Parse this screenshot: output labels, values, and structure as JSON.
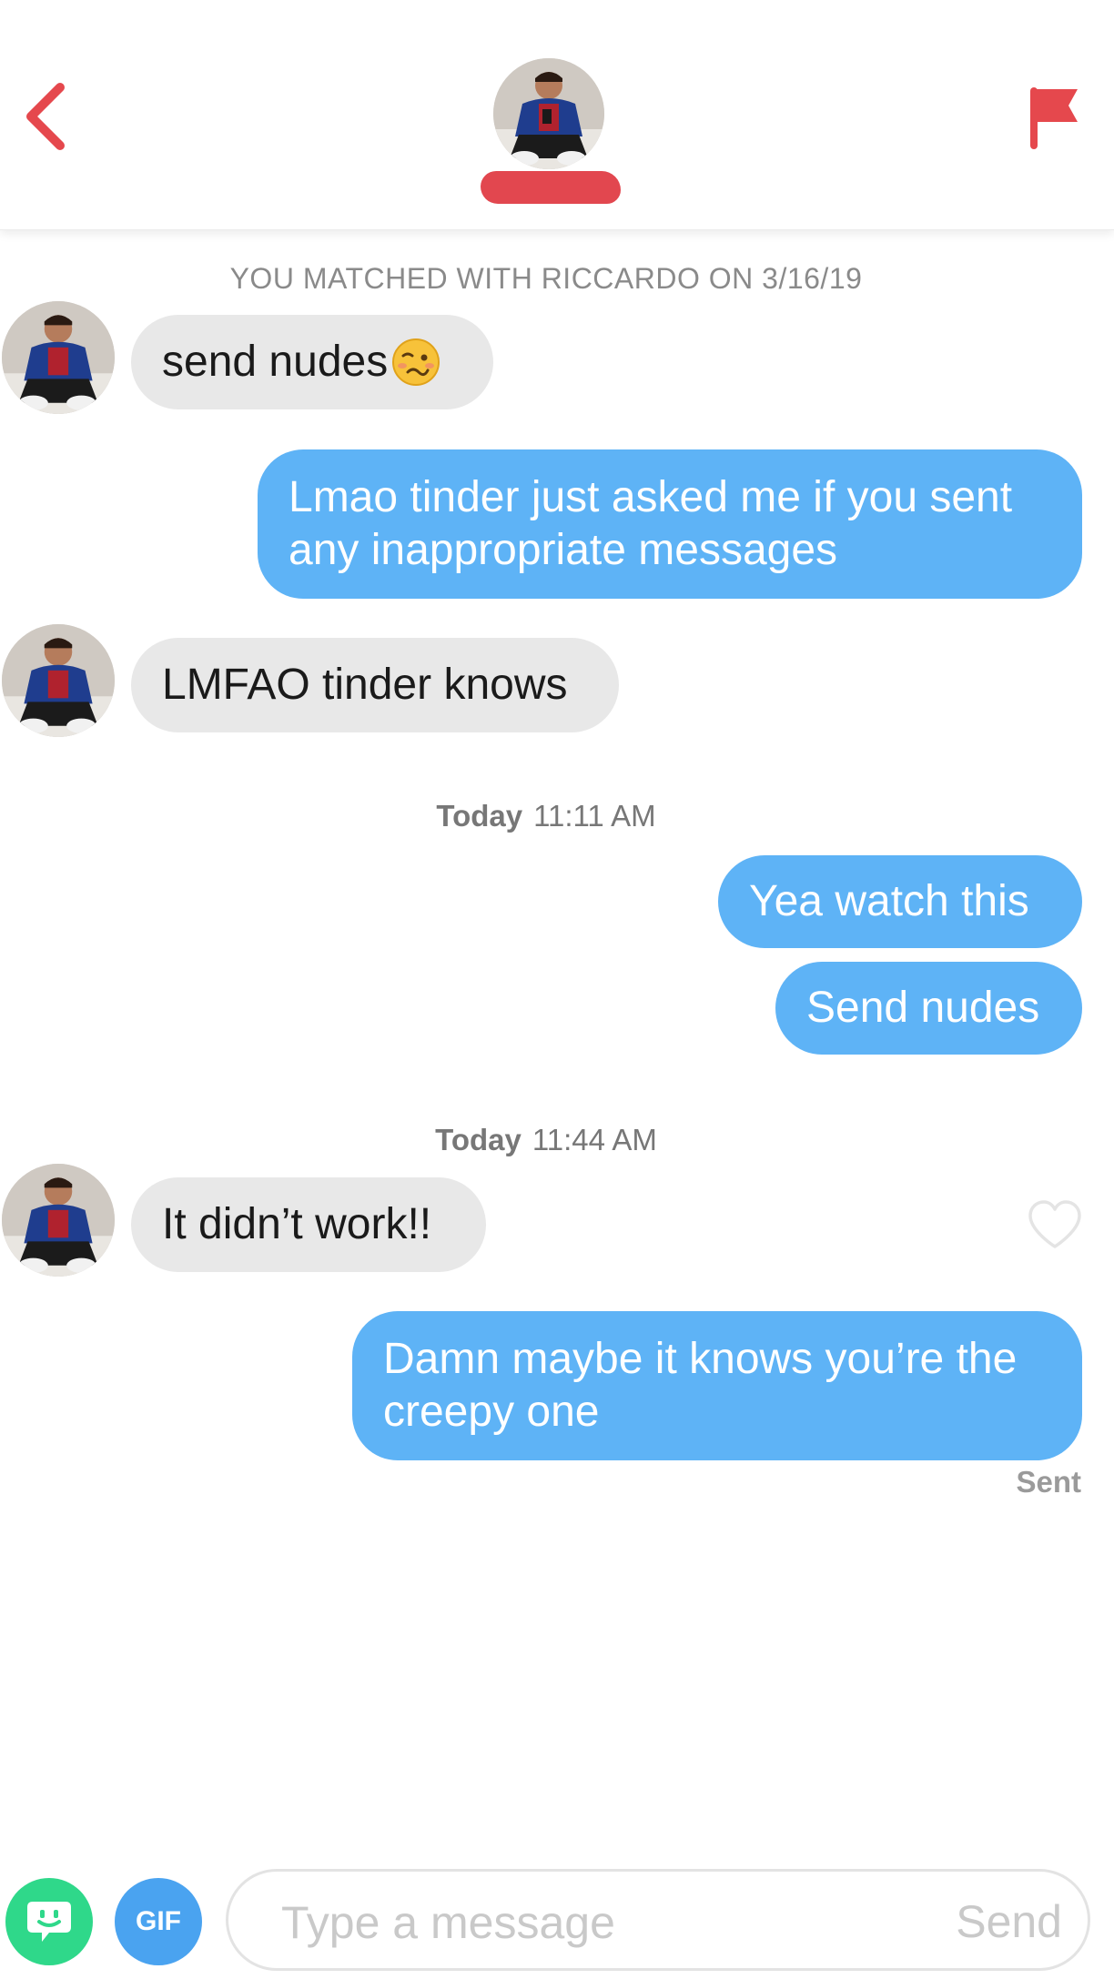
{
  "header": {
    "back_icon": "chevron-left-icon",
    "report_icon": "flag-icon",
    "accent_color": "#e5484d"
  },
  "match_banner": "YOU MATCHED WITH RICCARDO ON 3/16/19",
  "messages": [
    {
      "direction": "incoming",
      "text": "send nudes",
      "emoji": "woozy-face"
    },
    {
      "direction": "outgoing",
      "text": "Lmao tinder just asked me if you sent\nany inappropriate messages"
    },
    {
      "direction": "incoming",
      "text": "LMFAO tinder knows"
    },
    {
      "direction": "outgoing",
      "text": "Yea watch this"
    },
    {
      "direction": "outgoing",
      "text": "Send nudes"
    },
    {
      "direction": "incoming",
      "text": "It didn’t work!!"
    },
    {
      "direction": "outgoing",
      "text": "Damn maybe it knows you’re the\ncreepy one"
    }
  ],
  "timestamps": [
    {
      "day": "Today",
      "time": "11:11 AM"
    },
    {
      "day": "Today",
      "time": "11:44 AM"
    }
  ],
  "status": {
    "last_sent": "Sent"
  },
  "composer": {
    "sticker_icon": "sticker-icon",
    "gif_label": "GIF",
    "placeholder": "Type a message",
    "send_label": "Send"
  },
  "colors": {
    "outgoing_bubble": "#5eb3f6",
    "incoming_bubble": "#e8e8e8",
    "sticker_button": "#2fd88a",
    "gif_button": "#4aa3f0"
  }
}
